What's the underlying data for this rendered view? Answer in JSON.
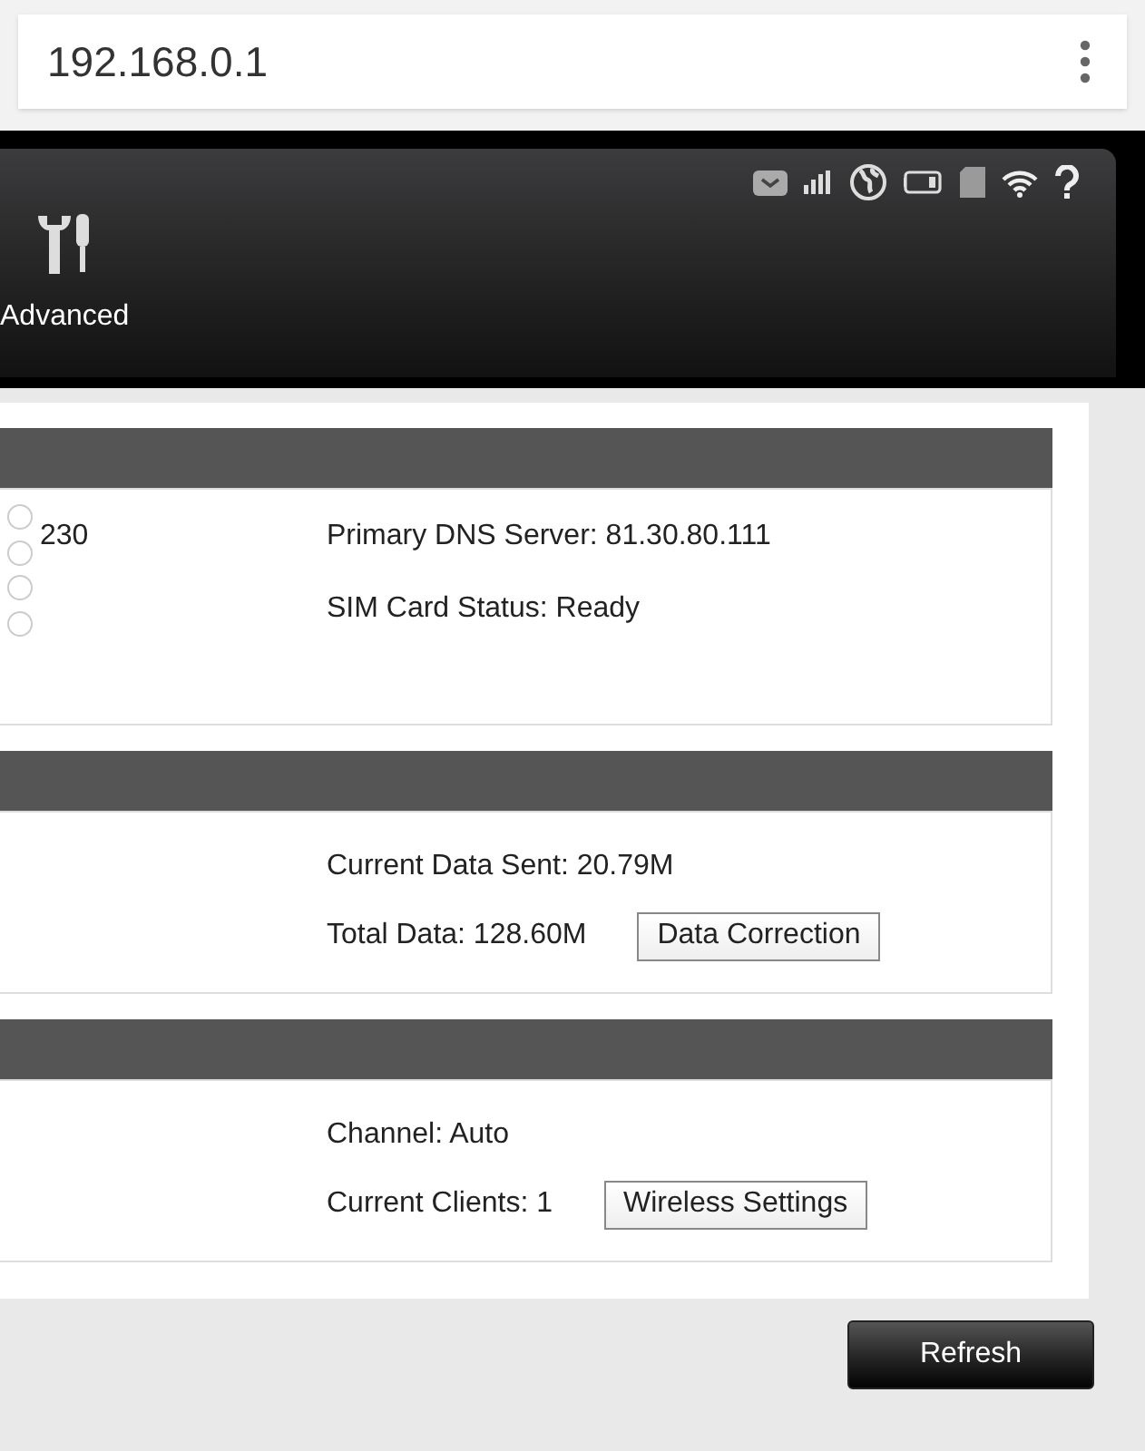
{
  "address_bar": {
    "url": "192.168.0.1"
  },
  "header": {
    "nav_items": [
      {
        "label": "Advanced"
      }
    ]
  },
  "sections": [
    {
      "left": [
        {
          "text": "230"
        }
      ],
      "radios": [
        {
          "selected": false
        },
        {
          "selected": false
        },
        {
          "selected": false
        },
        {
          "selected": false
        }
      ],
      "right": [
        {
          "kind": "text",
          "text": "Primary DNS Server: 81.30.80.111"
        },
        {
          "kind": "text",
          "text": "SIM Card Status: Ready"
        }
      ]
    },
    {
      "right": [
        {
          "kind": "text",
          "text": "Current Data Sent: 20.79M"
        },
        {
          "kind": "button",
          "text": "Total Data: 128.60M",
          "button": "Data Correction"
        }
      ]
    },
    {
      "right": [
        {
          "kind": "text",
          "text": "Channel: Auto"
        },
        {
          "kind": "button",
          "text": "Current Clients: 1",
          "button": "Wireless Settings"
        }
      ]
    }
  ],
  "refresh_button": "Refresh"
}
